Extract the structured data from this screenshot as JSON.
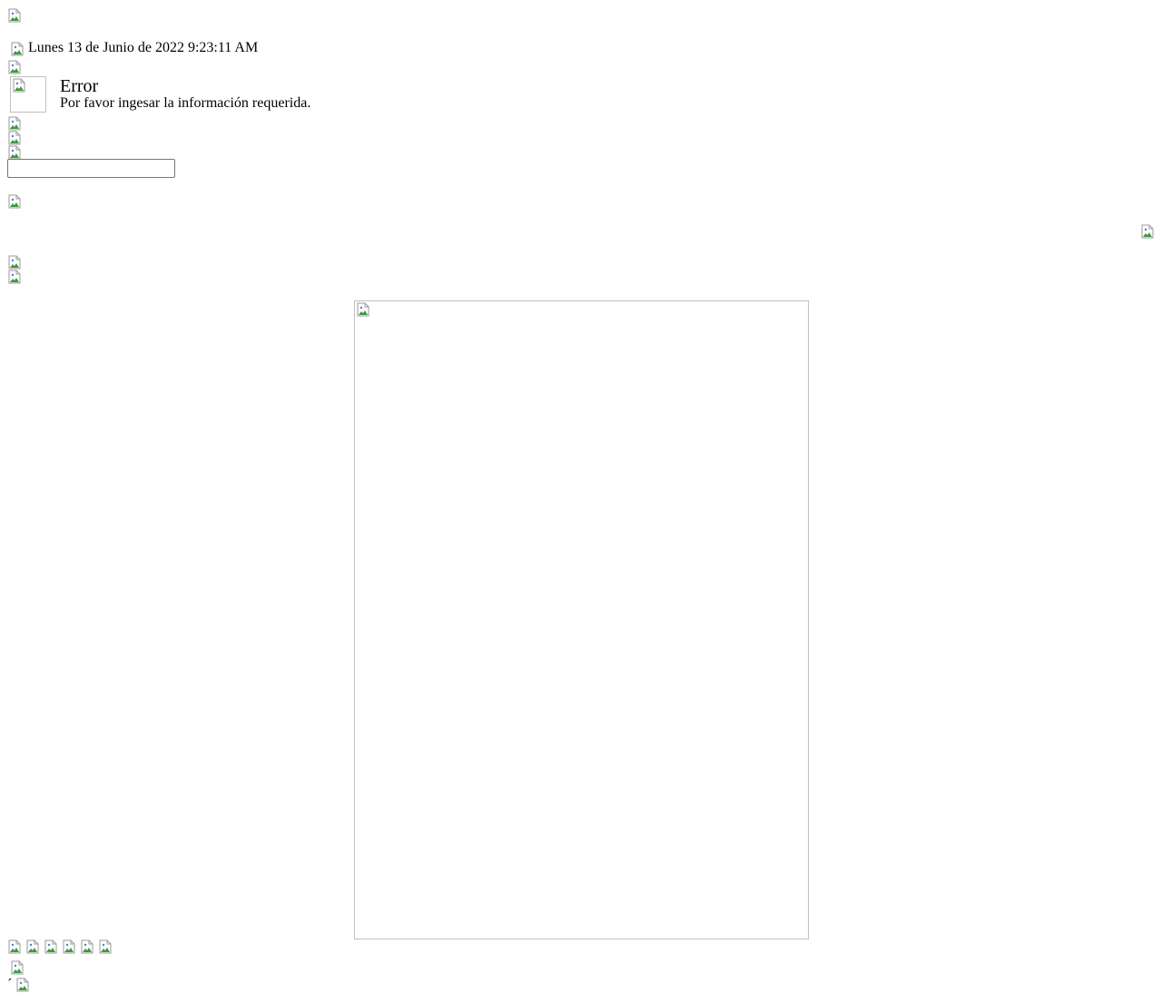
{
  "header": {
    "datetime": "Lunes 13 de Junio de 2022 9:23:11 AM"
  },
  "error": {
    "title": "Error",
    "message": "Por favor ingesar la información requerida."
  },
  "form": {
    "input_value": "",
    "input_placeholder": ""
  },
  "footer": {
    "stray_char": "´"
  },
  "icons": {
    "placeholder": "broken-image-icon"
  },
  "colors": {
    "frame_border": "#c0c0c0",
    "input_border": "#767676"
  }
}
